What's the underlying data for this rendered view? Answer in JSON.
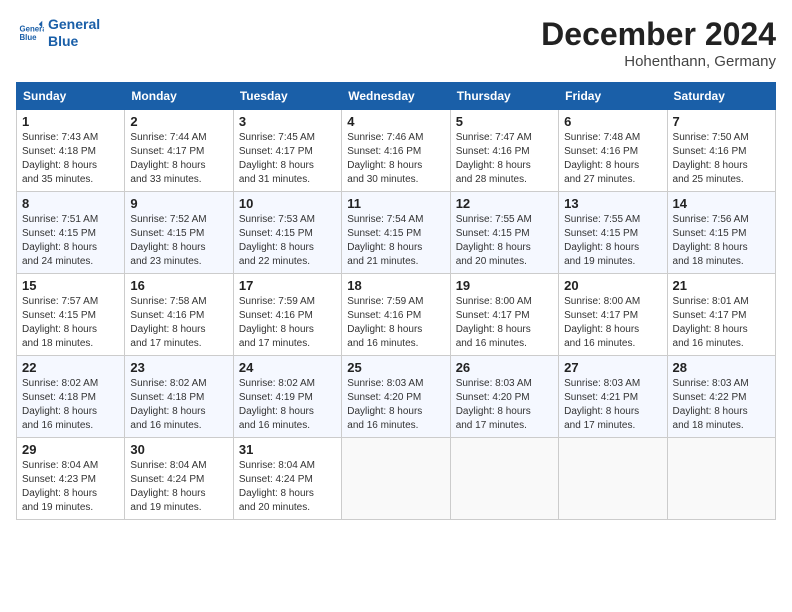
{
  "header": {
    "logo_line1": "General",
    "logo_line2": "Blue",
    "month": "December 2024",
    "location": "Hohenthann, Germany"
  },
  "columns": [
    "Sunday",
    "Monday",
    "Tuesday",
    "Wednesday",
    "Thursday",
    "Friday",
    "Saturday"
  ],
  "weeks": [
    [
      {
        "day": "1",
        "info": "Sunrise: 7:43 AM\nSunset: 4:18 PM\nDaylight: 8 hours\nand 35 minutes."
      },
      {
        "day": "2",
        "info": "Sunrise: 7:44 AM\nSunset: 4:17 PM\nDaylight: 8 hours\nand 33 minutes."
      },
      {
        "day": "3",
        "info": "Sunrise: 7:45 AM\nSunset: 4:17 PM\nDaylight: 8 hours\nand 31 minutes."
      },
      {
        "day": "4",
        "info": "Sunrise: 7:46 AM\nSunset: 4:16 PM\nDaylight: 8 hours\nand 30 minutes."
      },
      {
        "day": "5",
        "info": "Sunrise: 7:47 AM\nSunset: 4:16 PM\nDaylight: 8 hours\nand 28 minutes."
      },
      {
        "day": "6",
        "info": "Sunrise: 7:48 AM\nSunset: 4:16 PM\nDaylight: 8 hours\nand 27 minutes."
      },
      {
        "day": "7",
        "info": "Sunrise: 7:50 AM\nSunset: 4:16 PM\nDaylight: 8 hours\nand 25 minutes."
      }
    ],
    [
      {
        "day": "8",
        "info": "Sunrise: 7:51 AM\nSunset: 4:15 PM\nDaylight: 8 hours\nand 24 minutes."
      },
      {
        "day": "9",
        "info": "Sunrise: 7:52 AM\nSunset: 4:15 PM\nDaylight: 8 hours\nand 23 minutes."
      },
      {
        "day": "10",
        "info": "Sunrise: 7:53 AM\nSunset: 4:15 PM\nDaylight: 8 hours\nand 22 minutes."
      },
      {
        "day": "11",
        "info": "Sunrise: 7:54 AM\nSunset: 4:15 PM\nDaylight: 8 hours\nand 21 minutes."
      },
      {
        "day": "12",
        "info": "Sunrise: 7:55 AM\nSunset: 4:15 PM\nDaylight: 8 hours\nand 20 minutes."
      },
      {
        "day": "13",
        "info": "Sunrise: 7:55 AM\nSunset: 4:15 PM\nDaylight: 8 hours\nand 19 minutes."
      },
      {
        "day": "14",
        "info": "Sunrise: 7:56 AM\nSunset: 4:15 PM\nDaylight: 8 hours\nand 18 minutes."
      }
    ],
    [
      {
        "day": "15",
        "info": "Sunrise: 7:57 AM\nSunset: 4:15 PM\nDaylight: 8 hours\nand 18 minutes."
      },
      {
        "day": "16",
        "info": "Sunrise: 7:58 AM\nSunset: 4:16 PM\nDaylight: 8 hours\nand 17 minutes."
      },
      {
        "day": "17",
        "info": "Sunrise: 7:59 AM\nSunset: 4:16 PM\nDaylight: 8 hours\nand 17 minutes."
      },
      {
        "day": "18",
        "info": "Sunrise: 7:59 AM\nSunset: 4:16 PM\nDaylight: 8 hours\nand 16 minutes."
      },
      {
        "day": "19",
        "info": "Sunrise: 8:00 AM\nSunset: 4:17 PM\nDaylight: 8 hours\nand 16 minutes."
      },
      {
        "day": "20",
        "info": "Sunrise: 8:00 AM\nSunset: 4:17 PM\nDaylight: 8 hours\nand 16 minutes."
      },
      {
        "day": "21",
        "info": "Sunrise: 8:01 AM\nSunset: 4:17 PM\nDaylight: 8 hours\nand 16 minutes."
      }
    ],
    [
      {
        "day": "22",
        "info": "Sunrise: 8:02 AM\nSunset: 4:18 PM\nDaylight: 8 hours\nand 16 minutes."
      },
      {
        "day": "23",
        "info": "Sunrise: 8:02 AM\nSunset: 4:18 PM\nDaylight: 8 hours\nand 16 minutes."
      },
      {
        "day": "24",
        "info": "Sunrise: 8:02 AM\nSunset: 4:19 PM\nDaylight: 8 hours\nand 16 minutes."
      },
      {
        "day": "25",
        "info": "Sunrise: 8:03 AM\nSunset: 4:20 PM\nDaylight: 8 hours\nand 16 minutes."
      },
      {
        "day": "26",
        "info": "Sunrise: 8:03 AM\nSunset: 4:20 PM\nDaylight: 8 hours\nand 17 minutes."
      },
      {
        "day": "27",
        "info": "Sunrise: 8:03 AM\nSunset: 4:21 PM\nDaylight: 8 hours\nand 17 minutes."
      },
      {
        "day": "28",
        "info": "Sunrise: 8:03 AM\nSunset: 4:22 PM\nDaylight: 8 hours\nand 18 minutes."
      }
    ],
    [
      {
        "day": "29",
        "info": "Sunrise: 8:04 AM\nSunset: 4:23 PM\nDaylight: 8 hours\nand 19 minutes."
      },
      {
        "day": "30",
        "info": "Sunrise: 8:04 AM\nSunset: 4:24 PM\nDaylight: 8 hours\nand 19 minutes."
      },
      {
        "day": "31",
        "info": "Sunrise: 8:04 AM\nSunset: 4:24 PM\nDaylight: 8 hours\nand 20 minutes."
      },
      null,
      null,
      null,
      null
    ]
  ]
}
